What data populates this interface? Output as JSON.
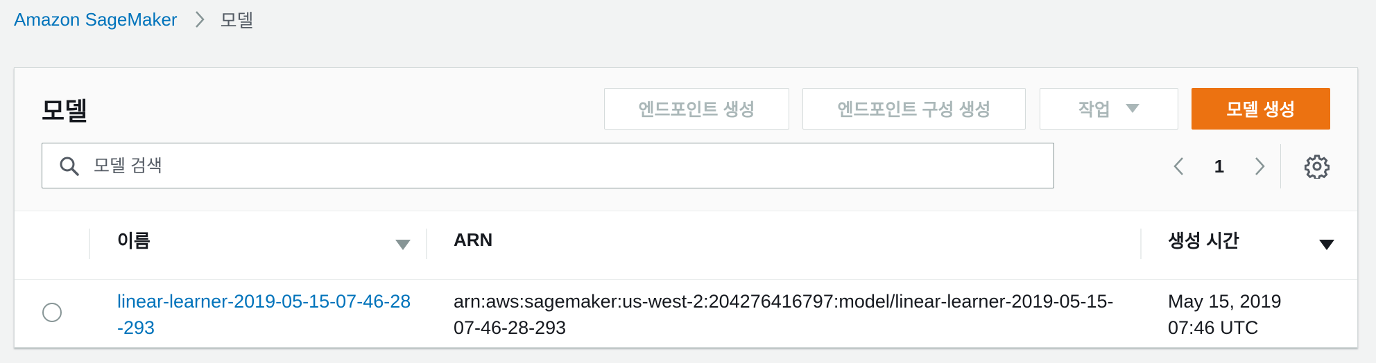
{
  "breadcrumb": {
    "root": "Amazon SageMaker",
    "current": "모델"
  },
  "panel": {
    "title": "모델",
    "buttons": {
      "create_endpoint": "엔드포인트 생성",
      "create_endpoint_config": "엔드포인트 구성 생성",
      "actions": "작업",
      "create_model": "모델 생성"
    },
    "search": {
      "placeholder": "모델 검색",
      "value": ""
    },
    "pagination": {
      "current_page": "1"
    }
  },
  "table": {
    "columns": {
      "name": "이름",
      "arn": "ARN",
      "created": "생성 시간"
    },
    "rows": [
      {
        "name": "linear-learner-2019-05-15-07-46-28-293",
        "arn": "arn:aws:sagemaker:us-west-2:204276416797:model/linear-learner-2019-05-15-07-46-28-293",
        "created_date": "May 15, 2019",
        "created_time": "07:46 UTC"
      }
    ]
  },
  "colors": {
    "link": "#0073bb",
    "primary": "#ec7211",
    "disabled_text": "#aab7b8",
    "background": "#f2f3f3"
  },
  "icons": [
    "chevron-right-icon",
    "caret-down-icon",
    "search-icon",
    "chevron-left-icon",
    "gear-icon",
    "sort-icon",
    "sort-desc-icon"
  ]
}
